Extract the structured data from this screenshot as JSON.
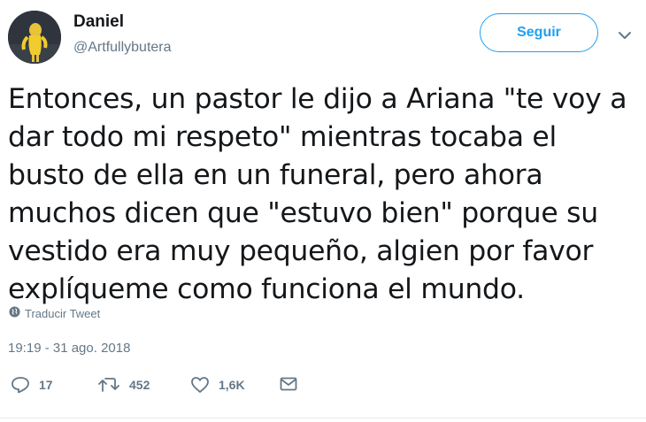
{
  "user": {
    "name": "Daniel",
    "handle": "@Artfullybutera"
  },
  "follow_button": {
    "label": "Seguir",
    "color": "#1da1f2"
  },
  "tweet": {
    "text": "Entonces, un pastor le dijo a Ariana \"te voy a dar todo mi respeto\" mientras tocaba el busto de ella en un funeral, pero ahora muchos dicen que \"estuvo bien\" porque su vestido era muy pequeño, algien por favor explíqueme como funciona el mundo.",
    "translate_label": "Traducir Tweet",
    "timestamp": "19:19 - 31 ago. 2018"
  },
  "actions": {
    "reply_count": "17",
    "retweet_count": "452",
    "like_count": "1,6K"
  },
  "icons": {
    "avatar": "avatar-image",
    "menu": "chevron-down-icon",
    "translate": "globe-icon",
    "reply": "reply-icon",
    "retweet": "retweet-icon",
    "like": "heart-icon",
    "message": "envelope-icon"
  }
}
